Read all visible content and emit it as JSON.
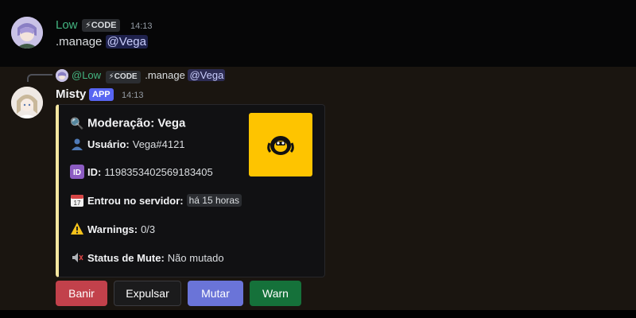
{
  "message1": {
    "author": "Low",
    "tag": "CODE",
    "time": "14:13",
    "command": ".manage",
    "mention": "@Vega"
  },
  "reply": {
    "author": "@Low",
    "tag": "CODE",
    "command": ".manage",
    "mention": "@Vega"
  },
  "message2": {
    "author": "Misty",
    "tag": "APP",
    "time": "14:13"
  },
  "embed": {
    "accent_color": "#f5e6a0",
    "title": "Moderação: Vega",
    "fields": {
      "user_label": "Usuário:",
      "user_value": "Vega#4121",
      "id_label": "ID:",
      "id_value": "1198353402569183405",
      "joined_label": "Entrou no servidor:",
      "joined_value": "há 15 horas",
      "warnings_label": "Warnings:",
      "warnings_value": "0/3",
      "mute_label": "Status de Mute:",
      "mute_value": "Não mutado"
    },
    "thumbnail_color": "#fec400"
  },
  "buttons": {
    "ban": "Banir",
    "kick": "Expulsar",
    "mute": "Mutar",
    "warn": "Warn"
  },
  "colors": {
    "ban": "#c2414b",
    "mute": "#6a74d8",
    "warn": "#15713a",
    "app_tag": "#5865f2",
    "author1": "#43b581"
  }
}
